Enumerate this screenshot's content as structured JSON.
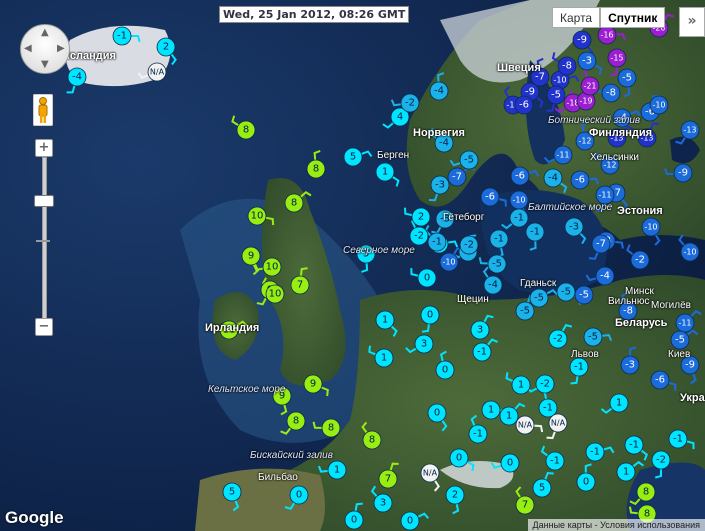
{
  "timestamp": "Wed, 25 Jan 2012, 08:26 GMT",
  "map_types": [
    {
      "label": "Карта",
      "active": false
    },
    {
      "label": "Спутник",
      "active": true
    }
  ],
  "expand_label": "»",
  "zoom": {
    "plus_label": "+",
    "minus_label": "−",
    "level": 0.75
  },
  "logo": "Google",
  "attribution": "Данные карты - Условия использования",
  "labels": [
    {
      "text": "Исландия",
      "kind": "country"
    },
    {
      "text": "Швеция",
      "kind": "country"
    },
    {
      "text": "Норвегия",
      "kind": "country"
    },
    {
      "text": "Финляндия",
      "kind": "country"
    },
    {
      "text": "Хельсинки",
      "kind": "city"
    },
    {
      "text": "Эстония",
      "kind": "country"
    },
    {
      "text": "Берген",
      "kind": "city"
    },
    {
      "text": "Ботнический залив",
      "kind": "sea"
    },
    {
      "text": "Балтийское море",
      "kind": "sea"
    },
    {
      "text": "Северное море",
      "kind": "sea"
    },
    {
      "text": "Гётеборг",
      "kind": "city"
    },
    {
      "text": "Ирландия",
      "kind": "country"
    },
    {
      "text": "Кельтское море",
      "kind": "sea"
    },
    {
      "text": "Бискайский залив",
      "kind": "sea"
    },
    {
      "text": "Бильбао",
      "kind": "city"
    },
    {
      "text": "Гданьск",
      "kind": "city"
    },
    {
      "text": "Вильнюс",
      "kind": "city"
    },
    {
      "text": "Минск",
      "kind": "city"
    },
    {
      "text": "Беларусь",
      "kind": "country"
    },
    {
      "text": "Щецин",
      "kind": "city"
    },
    {
      "text": "Киев",
      "kind": "city"
    },
    {
      "text": "Украина",
      "kind": "country"
    },
    {
      "text": "Львов",
      "kind": "city"
    },
    {
      "text": "Могилёв",
      "kind": "city"
    }
  ],
  "stations": [
    {
      "value": "-1",
      "color": "#00e5ff"
    },
    {
      "value": "2",
      "color": "#00e5ff"
    },
    {
      "value": "-4",
      "color": "#00e5ff"
    },
    {
      "value": "N/A",
      "color": "#f2f2f2"
    },
    {
      "value": "8",
      "color": "#99ee11"
    },
    {
      "value": "8",
      "color": "#99ee11"
    },
    {
      "value": "8",
      "color": "#99ee11"
    },
    {
      "value": "10",
      "color": "#99ee11"
    },
    {
      "value": "9",
      "color": "#99ee11"
    },
    {
      "value": "9",
      "color": "#99ee11"
    },
    {
      "value": "10",
      "color": "#99ee11"
    },
    {
      "value": "10",
      "color": "#99ee11"
    },
    {
      "value": "7",
      "color": "#99ee11"
    },
    {
      "value": "11",
      "color": "#99ee11"
    },
    {
      "value": "9",
      "color": "#99ee11"
    },
    {
      "value": "9",
      "color": "#99ee11"
    },
    {
      "value": "8",
      "color": "#99ee11"
    },
    {
      "value": "8",
      "color": "#99ee11"
    },
    {
      "value": "8",
      "color": "#99ee11"
    },
    {
      "value": "7",
      "color": "#99ee11"
    },
    {
      "value": "5",
      "color": "#00e5ff"
    },
    {
      "value": "1",
      "color": "#00e5ff"
    },
    {
      "value": "5",
      "color": "#00e5ff"
    },
    {
      "value": "4",
      "color": "#00e5ff"
    },
    {
      "value": "2",
      "color": "#00e5ff"
    },
    {
      "value": "-2",
      "color": "#00e5ff"
    },
    {
      "value": "3",
      "color": "#00e5ff"
    },
    {
      "value": "-2",
      "color": "#00e5ff"
    },
    {
      "value": "1",
      "color": "#00e5ff"
    },
    {
      "value": "0",
      "color": "#00e5ff"
    },
    {
      "value": "3",
      "color": "#00e5ff"
    },
    {
      "value": "1",
      "color": "#00e5ff"
    },
    {
      "value": "0",
      "color": "#00e5ff"
    },
    {
      "value": "-1",
      "color": "#00e5ff"
    },
    {
      "value": "1",
      "color": "#00e5ff"
    },
    {
      "value": "0",
      "color": "#00e5ff"
    },
    {
      "value": "-3",
      "color": "#1ab2e8"
    },
    {
      "value": "-5",
      "color": "#1ab2e8"
    },
    {
      "value": "-4",
      "color": "#1ab2e8"
    },
    {
      "value": "-4",
      "color": "#1ab2e8"
    },
    {
      "value": "-7",
      "color": "#1c6bdb"
    },
    {
      "value": "-6",
      "color": "#1c6bdb"
    },
    {
      "value": "-10",
      "color": "#1c6bdb"
    },
    {
      "value": "-3",
      "color": "#1ab2e8"
    },
    {
      "value": "-2",
      "color": "#1ab2e8"
    },
    {
      "value": "-1",
      "color": "#1ab2e8"
    },
    {
      "value": "-3",
      "color": "#1ab2e8"
    },
    {
      "value": "-5",
      "color": "#1ab2e8"
    },
    {
      "value": "-5",
      "color": "#1ab2e8"
    },
    {
      "value": "-1",
      "color": "#1ab2e8"
    },
    {
      "value": "-2",
      "color": "#1ab2e8"
    },
    {
      "value": "-5",
      "color": "#1ab2e8"
    },
    {
      "value": "-4",
      "color": "#1ab2e8"
    },
    {
      "value": "-5",
      "color": "#1ab2e8"
    },
    {
      "value": "-6",
      "color": "#1c6bdb"
    },
    {
      "value": "-4",
      "color": "#1ab2e8"
    },
    {
      "value": "-1",
      "color": "#1ab2e8"
    },
    {
      "value": "-1",
      "color": "#1ab2e8"
    },
    {
      "value": "0",
      "color": "#00e5ff"
    },
    {
      "value": "-1",
      "color": "#00e5ff"
    },
    {
      "value": "-2",
      "color": "#00e5ff"
    },
    {
      "value": "-5",
      "color": "#1ab2e8"
    },
    {
      "value": "-3",
      "color": "#1ab2e8"
    },
    {
      "value": "-1",
      "color": "#00e5ff"
    },
    {
      "value": "-2",
      "color": "#00e5ff"
    },
    {
      "value": "1",
      "color": "#00e5ff"
    },
    {
      "value": "-1",
      "color": "#00e5ff"
    },
    {
      "value": "1",
      "color": "#00e5ff"
    },
    {
      "value": "N/A",
      "color": "#f2f2f2"
    },
    {
      "value": "N/A",
      "color": "#f2f2f2"
    },
    {
      "value": "N/A",
      "color": "#f2f2f2"
    },
    {
      "value": "0",
      "color": "#00e5ff"
    },
    {
      "value": "-1",
      "color": "#00e5ff"
    },
    {
      "value": "0",
      "color": "#00e5ff"
    },
    {
      "value": "1",
      "color": "#00e5ff"
    },
    {
      "value": "-1",
      "color": "#00e5ff"
    },
    {
      "value": "5",
      "color": "#00e5ff"
    },
    {
      "value": "0",
      "color": "#00e5ff"
    },
    {
      "value": "1",
      "color": "#00e5ff"
    },
    {
      "value": "3",
      "color": "#00e5ff"
    },
    {
      "value": "0",
      "color": "#00e5ff"
    },
    {
      "value": "0",
      "color": "#00e5ff"
    },
    {
      "value": "0",
      "color": "#00e5ff"
    },
    {
      "value": "2",
      "color": "#00e5ff"
    },
    {
      "value": "8",
      "color": "#99ee11"
    },
    {
      "value": "8",
      "color": "#99ee11"
    },
    {
      "value": "7",
      "color": "#99ee11"
    },
    {
      "value": "5",
      "color": "#00e5ff"
    },
    {
      "value": "-1",
      "color": "#00e5ff"
    },
    {
      "value": "-1",
      "color": "#00e5ff"
    },
    {
      "value": "-2",
      "color": "#00e5ff"
    },
    {
      "value": "1",
      "color": "#00e5ff"
    },
    {
      "value": "-5",
      "color": "#1c6bdb"
    },
    {
      "value": "-8",
      "color": "#1c6bdb"
    },
    {
      "value": "-10",
      "color": "#1c6bdb"
    },
    {
      "value": "-6",
      "color": "#1c6bdb"
    },
    {
      "value": "-7",
      "color": "#1c6bdb"
    },
    {
      "value": "-11",
      "color": "#1c6bdb"
    },
    {
      "value": "-11",
      "color": "#1c6bdb"
    },
    {
      "value": "-12",
      "color": "#1c6bdb"
    },
    {
      "value": "-12",
      "color": "#1c6bdb"
    },
    {
      "value": "-11",
      "color": "#1c6bdb"
    },
    {
      "value": "-8",
      "color": "#1c6bdb"
    },
    {
      "value": "-10",
      "color": "#1c6bdb"
    },
    {
      "value": "-7",
      "color": "#1c6bdb"
    },
    {
      "value": "-4",
      "color": "#1c6bdb"
    },
    {
      "value": "-2",
      "color": "#1c6bdb"
    },
    {
      "value": "-3",
      "color": "#1c6bdb"
    },
    {
      "value": "-5",
      "color": "#1c6bdb"
    },
    {
      "value": "-6",
      "color": "#1c6bdb"
    },
    {
      "value": "-9",
      "color": "#1c6bdb"
    },
    {
      "value": "-13",
      "color": "#1c6bdb"
    },
    {
      "value": "-9",
      "color": "#1c6bdb"
    },
    {
      "value": "-10",
      "color": "#1c6bdb"
    },
    {
      "value": "-6",
      "color": "#1c6bdb"
    },
    {
      "value": "-4",
      "color": "#1c6bdb"
    },
    {
      "value": "-3",
      "color": "#1c6bdb"
    },
    {
      "value": "-5",
      "color": "#1c6bdb"
    },
    {
      "value": "-10",
      "color": "#1c6bdb"
    },
    {
      "value": "-8",
      "color": "#1c6bdb"
    },
    {
      "value": "-14",
      "color": "#2233cc"
    },
    {
      "value": "-13",
      "color": "#2233cc"
    },
    {
      "value": "-10",
      "color": "#2233cc"
    },
    {
      "value": "-9",
      "color": "#2233cc"
    },
    {
      "value": "-15",
      "color": "#9b1fd1"
    },
    {
      "value": "-18",
      "color": "#9b1fd1"
    },
    {
      "value": "-19",
      "color": "#9b1fd1"
    },
    {
      "value": "-21",
      "color": "#9b1fd1"
    },
    {
      "value": "-20",
      "color": "#9b1fd1"
    },
    {
      "value": "-16",
      "color": "#9b1fd1"
    },
    {
      "value": "-9",
      "color": "#2233cc"
    },
    {
      "value": "-5",
      "color": "#2233cc"
    },
    {
      "value": "-6",
      "color": "#2233cc"
    },
    {
      "value": "-8",
      "color": "#2233cc"
    },
    {
      "value": "-7",
      "color": "#2233cc"
    },
    {
      "value": "-13",
      "color": "#2233cc"
    }
  ]
}
